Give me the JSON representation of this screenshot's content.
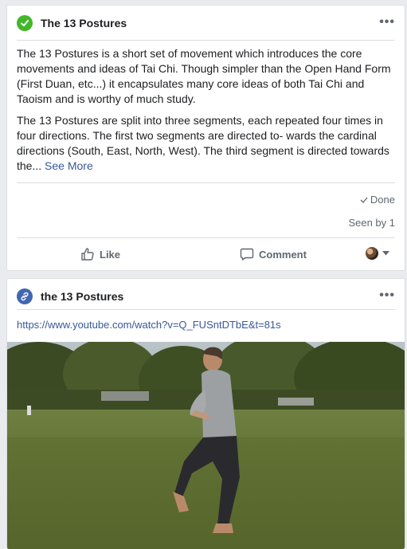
{
  "post1": {
    "title": "The 13 Postures",
    "paragraph1": "The 13 Postures is a short set of movement which introduces the core movements and ideas of Tai Chi. Though simpler than the Open Hand Form (First Duan, etc...) it encapsulates many core ideas of both Tai Chi and Taoism and is worthy of much study.",
    "paragraph2": "The 13 Postures are split into three segments, each repeated four times in four directions. The first two segments are directed to- wards the cardinal directions (South, East, North, West). The third segment is directed towards the...",
    "see_more": "See More",
    "done_label": "Done",
    "seen_by": "Seen by 1",
    "like_label": "Like",
    "comment_label": "Comment",
    "check_color": "#42b72a",
    "icons": {
      "status": "check-circle-icon",
      "like": "thumbs-up-icon",
      "comment": "comment-icon"
    }
  },
  "post2": {
    "title": "the 13 Postures",
    "url": "https://www.youtube.com/watch?v=Q_FUSntDTbE&t=81s",
    "link_icon_color": "#4267b2",
    "icons": {
      "status": "link-circle-icon"
    }
  }
}
